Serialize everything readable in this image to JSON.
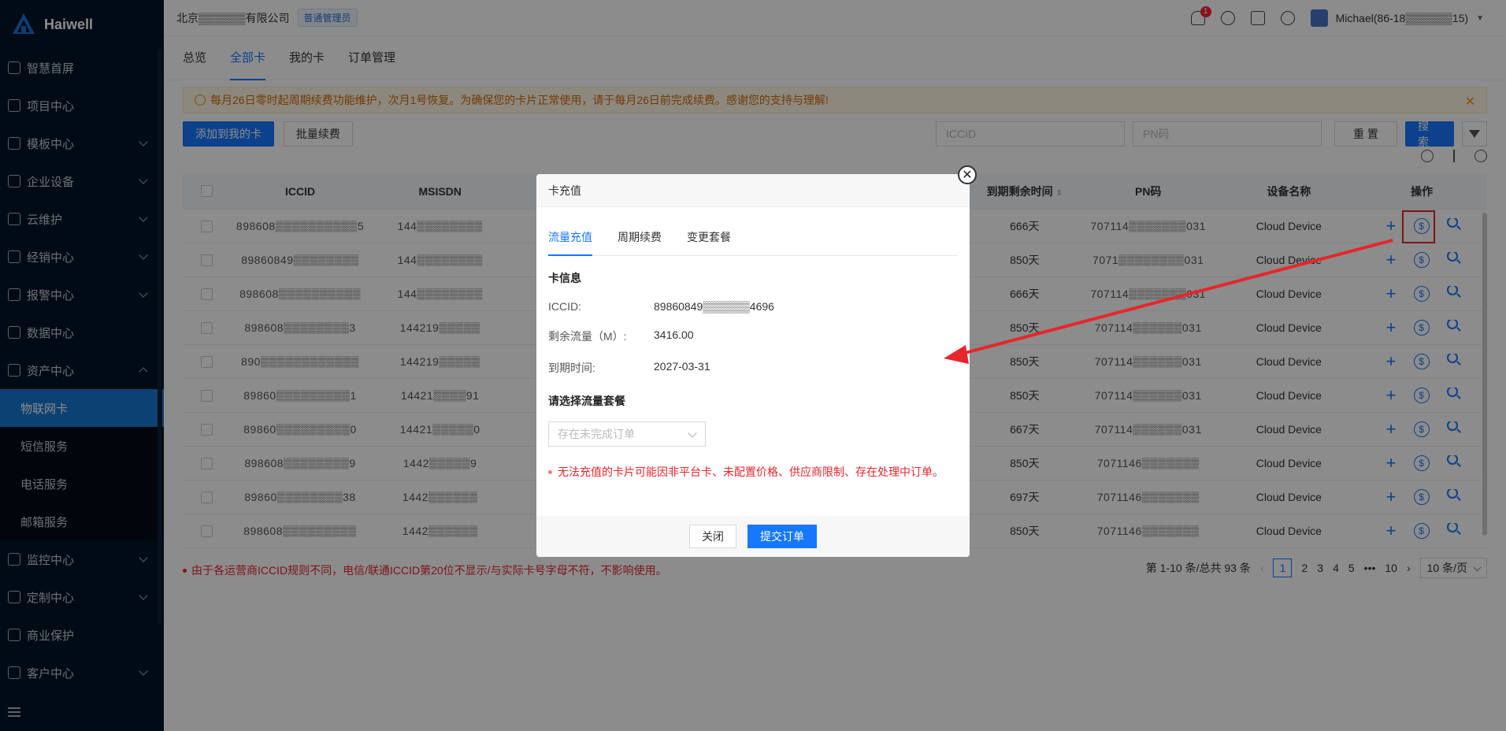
{
  "app": {
    "logo": "Haiwell"
  },
  "sidebar": {
    "items": [
      {
        "label": "智慧首屏",
        "icon": "globe-icon",
        "chevron": false
      },
      {
        "label": "项目中心",
        "icon": "list-icon",
        "chevron": false
      },
      {
        "label": "模板中心",
        "icon": "template-icon",
        "chevron": true
      },
      {
        "label": "企业设备",
        "icon": "device-icon",
        "chevron": true
      },
      {
        "label": "云维护",
        "icon": "cloud-icon",
        "chevron": true
      },
      {
        "label": "经销中心",
        "icon": "dealer-icon",
        "chevron": true
      },
      {
        "label": "报警中心",
        "icon": "alarm-icon",
        "chevron": true
      },
      {
        "label": "数据中心",
        "icon": "data-icon",
        "chevron": false
      },
      {
        "label": "资产中心",
        "icon": "asset-icon",
        "chevron": true,
        "expanded": true
      }
    ],
    "sub_items": [
      {
        "label": "物联网卡",
        "active": true
      },
      {
        "label": "短信服务",
        "active": false
      },
      {
        "label": "电话服务",
        "active": false
      },
      {
        "label": "邮箱服务",
        "active": false
      }
    ],
    "items_after": [
      {
        "label": "监控中心",
        "icon": "monitor-icon",
        "chevron": true
      },
      {
        "label": "定制中心",
        "icon": "custom-icon",
        "chevron": true
      },
      {
        "label": "商业保护",
        "icon": "shield-icon",
        "chevron": false
      },
      {
        "label": "客户中心",
        "icon": "user-icon",
        "chevron": true
      }
    ]
  },
  "header": {
    "company": "北京▒▒▒▒▒▒有限公司",
    "role": "普通管理员",
    "notification_count": "1",
    "user": "Michael(86-18▒▒▒▒▒▒15)"
  },
  "tabs": [
    {
      "label": "总览",
      "active": false
    },
    {
      "label": "全部卡",
      "active": true
    },
    {
      "label": "我的卡",
      "active": false
    },
    {
      "label": "订单管理",
      "active": false
    }
  ],
  "notice": "每月26日零时起周期续费功能维护，次月1号恢复。为确保您的卡片正常使用，请于每月26日前完成续费。感谢您的支持与理解!",
  "toolbar": {
    "add_label": "添加到我的卡",
    "renew_label": "批量续费",
    "iccid_placeholder": "ICCID",
    "pn_placeholder": "PN码",
    "reset_label": "重 置",
    "search_label": "搜 索"
  },
  "table": {
    "headers": {
      "iccid": "ICCID",
      "msisdn": "MSISDN",
      "remain": "到期剩余时间",
      "pn": "PN码",
      "device": "设备名称",
      "op": "操作"
    },
    "rows": [
      {
        "iccid": "898608▒▒▒▒▒▒▒▒▒▒5",
        "msisdn": "144▒▒▒▒▒▒▒▒",
        "remain": "666天",
        "pn": "707114▒▒▒▒▒▒▒031",
        "device": "Cloud Device"
      },
      {
        "iccid": "89860849▒▒▒▒▒▒▒▒",
        "msisdn": "144▒▒▒▒▒▒▒▒",
        "remain": "850天",
        "pn": "7071▒▒▒▒▒▒▒▒031",
        "device": "Cloud Device"
      },
      {
        "iccid": "898608▒▒▒▒▒▒▒▒▒▒",
        "msisdn": "144▒▒▒▒▒▒▒▒",
        "remain": "666天",
        "pn": "707114▒▒▒▒▒▒▒031",
        "device": "Cloud Device"
      },
      {
        "iccid": "898608▒▒▒▒▒▒▒▒3",
        "msisdn": "144219▒▒▒▒▒",
        "remain": "850天",
        "pn": "707114▒▒▒▒▒▒031",
        "device": "Cloud Device"
      },
      {
        "iccid": "890▒▒▒▒▒▒▒▒▒▒▒▒",
        "msisdn": "144219▒▒▒▒▒",
        "remain": "850天",
        "pn": "707114▒▒▒▒▒▒031",
        "device": "Cloud Device"
      },
      {
        "iccid": "89860▒▒▒▒▒▒▒▒▒1",
        "msisdn": "14421▒▒▒▒91",
        "remain": "850天",
        "pn": "707114▒▒▒▒▒▒031",
        "device": "Cloud Device"
      },
      {
        "iccid": "89860▒▒▒▒▒▒▒▒▒0",
        "msisdn": "14421▒▒▒▒▒0",
        "remain": "667天",
        "pn": "707114▒▒▒▒▒▒031",
        "device": "Cloud Device"
      },
      {
        "iccid": "898608▒▒▒▒▒▒▒▒9",
        "msisdn": "1442▒▒▒▒▒9",
        "remain": "850天",
        "pn": "7071146▒▒▒▒▒▒▒",
        "device": "Cloud Device"
      },
      {
        "iccid": "89860▒▒▒▒▒▒▒▒38",
        "msisdn": "1442▒▒▒▒▒▒",
        "remain": "697天",
        "pn": "7071146▒▒▒▒▒▒▒",
        "device": "Cloud Device"
      },
      {
        "iccid": "898608▒▒▒▒▒▒▒▒▒",
        "msisdn": "1442▒▒▒▒▒▒",
        "remain": "850天",
        "pn": "7071146▒▒▒▒▒▒▒",
        "device": "Cloud Device"
      }
    ]
  },
  "footnote": "由于各运营商ICCID规则不同，电信/联通ICCID第20位不显示/与实际卡号字母不符，不影响使用。",
  "pager": {
    "summary": "第 1-10 条/总共 93 条",
    "pages": [
      "1",
      "2",
      "3",
      "4",
      "5",
      "•••",
      "10"
    ],
    "size": "10 条/页"
  },
  "modal": {
    "title": "卡充值",
    "tabs": [
      {
        "label": "流量充值",
        "active": true
      },
      {
        "label": "周期续费",
        "active": false
      },
      {
        "label": "变更套餐",
        "active": false
      }
    ],
    "section_info": "卡信息",
    "iccid_label": "ICCID:",
    "iccid_value": "89860849▒▒▒▒▒▒4696",
    "remain_label": "剩余流量（M）:",
    "remain_value": "3416.00",
    "expire_label": "到期时间:",
    "expire_value": "2027-03-31",
    "section_pkg": "请选择流量套餐",
    "select_placeholder": "存在未完成订单",
    "warning": "无法充值的卡片可能因非平台卡、未配置价格、供应商限制、存在处理中订单。",
    "close_label": "关闭",
    "submit_label": "提交订单"
  },
  "colors": {
    "primary": "#1677ff",
    "sidebar": "#001529",
    "danger": "#e6262c",
    "warning": "#fa8c16"
  }
}
